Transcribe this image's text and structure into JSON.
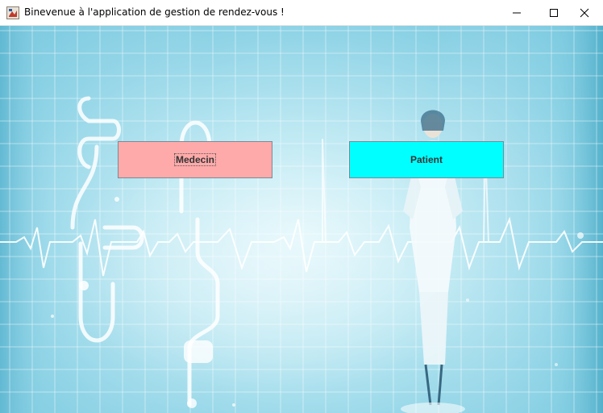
{
  "window": {
    "title": "Binevenue à l'application de gestion de rendez-vous !",
    "icon": "java-app-icon",
    "controls": [
      "minimize-icon",
      "maximize-icon",
      "close-icon"
    ]
  },
  "buttons": {
    "medecin": {
      "label": "Medecin",
      "color": "#ffaaaa",
      "focused": true
    },
    "patient": {
      "label": "Patient",
      "color": "#00ffff",
      "focused": false
    }
  },
  "background": {
    "image": "medical-ecg-grid-with-doctor",
    "colors": {
      "light": "#dff6fb",
      "mid": "#8ed3e6",
      "deep": "#6cc2db"
    }
  }
}
